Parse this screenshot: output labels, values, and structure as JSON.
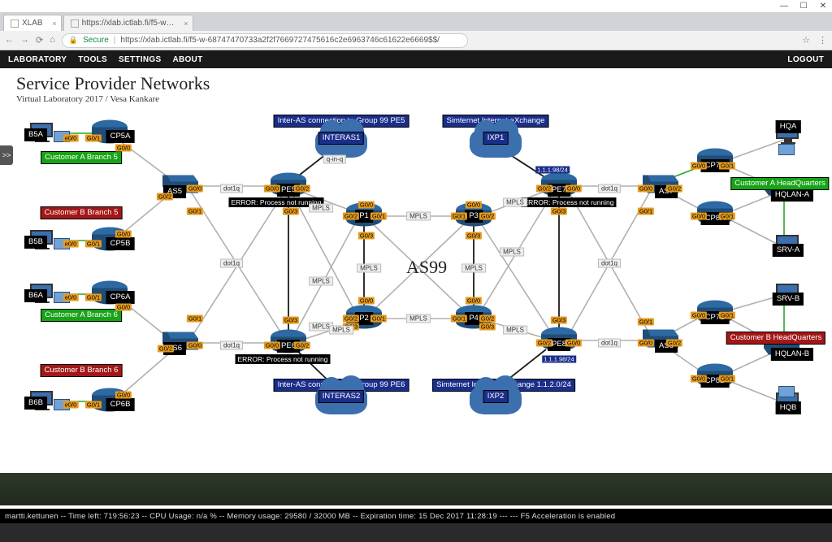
{
  "os": {
    "min": "—",
    "max": "☐",
    "close": "✕"
  },
  "browser": {
    "tabs": [
      {
        "title": "XLAB"
      },
      {
        "title": "https://xlab.ictlab.fi/f5-w…"
      }
    ],
    "secure_label": "Secure",
    "url": "https://xlab.ictlab.fi/f5-w-68747470733a2f2f7669727475616c2e6963746c61622e6669$$/",
    "nav": {
      "back": "←",
      "fwd": "→",
      "reload": "⟳",
      "home": "⌂"
    },
    "right": {
      "star": "☆",
      "menu": "⋮"
    }
  },
  "appnav": {
    "items": [
      "LABORATORY",
      "TOOLS",
      "SETTINGS",
      "ABOUT"
    ],
    "logout": "LOGOUT"
  },
  "page": {
    "title": "Service Provider Networks",
    "subtitle": "Virtual Laboratory 2017 / Vesa Kankare",
    "as_label": "AS99",
    "side_tab": ">>"
  },
  "nodes": {
    "B5A": "B5A",
    "CP5A": "CP5A",
    "B5B": "B5B",
    "CP5B": "CP5B",
    "B6A": "B6A",
    "CP6A": "CP6A",
    "B6B": "B6B",
    "CP6B": "CP6B",
    "AS5": "AS5",
    "AS6": "AS6",
    "AS7": "AS7",
    "AS8": "AS8",
    "PE5": "PE5",
    "PE6": "PE6",
    "PE7": "PE7",
    "PE8": "PE8",
    "P1": "P1",
    "P2": "P2",
    "P3": "P3",
    "P4": "P4",
    "CP7A": "CP7A",
    "CP8A": "CP8A",
    "CP7B": "CP7B",
    "CP8B": "CP8B",
    "HQA": "HQA",
    "SRV_A": "SRV-A",
    "SRV_B": "SRV-B",
    "HQB": "HQB",
    "HQLAN_A": "HQLAN-A",
    "HQLAN_B": "HQLAN-B",
    "INTERAS1": "INTERAS1",
    "INTERAS2": "INTERAS2",
    "IXP1": "IXP1",
    "IXP2": "IXP2"
  },
  "branches": {
    "custA5": "Customer A Branch 5",
    "custB5": "Customer B Branch 5",
    "custA6": "Customer A Branch 6",
    "custB6": "Customer B Branch 6",
    "custAHQ": "Customer A HeadQuarters",
    "custBHQ": "Customer B HeadQuarters"
  },
  "banners": {
    "interas1": "Inter-AS connection to Group 99 PE5",
    "interas2": "Inter-AS connection to Group 99 PE6",
    "ixp1": "Simternet Internet eXchange",
    "ixp2": "Simternet Internet eXchange 1.1.2.0/24"
  },
  "ip": {
    "pe7": "1.1.1.98/24",
    "pe8": "1.1.1.98/24"
  },
  "errors": {
    "pe5": "ERROR: Process not running",
    "pe6": "ERROR: Process not running",
    "pe7": "ERROR: Process not running"
  },
  "linklabels": {
    "mpls": "MPLS",
    "dot1q": "dot1q",
    "qinq": "q-in-q"
  },
  "ifaces": {
    "g00": "G0/0",
    "g01": "G0/1",
    "g02": "G0/2",
    "g03": "G0/3",
    "e0": "e0/0"
  },
  "status": "martti.kettunen -- Time left: 719:56:23 -- CPU Usage: n/a % -- Memory usage: 29580 / 32000 MB -- Expiration time: 15 Dec 2017 11:28:19 --- --- F5 Acceleration is enabled"
}
